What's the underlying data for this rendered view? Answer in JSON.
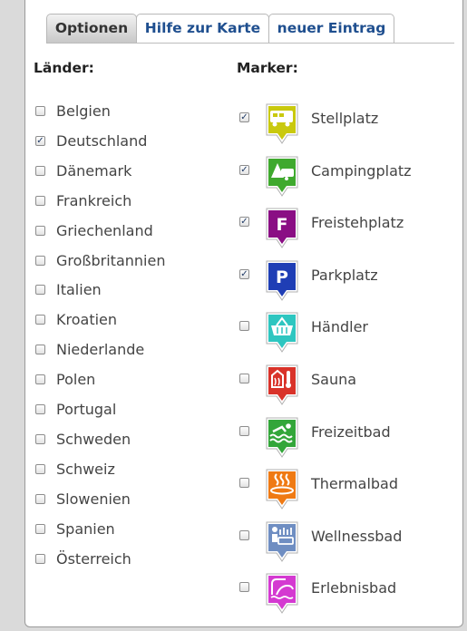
{
  "tabs": [
    {
      "label": "Optionen",
      "active": true
    },
    {
      "label": "Hilfe zur Karte",
      "active": false
    },
    {
      "label": "neuer Eintrag",
      "active": false
    }
  ],
  "countries": {
    "heading": "Länder:",
    "items": [
      {
        "label": "Belgien",
        "checked": false
      },
      {
        "label": "Deutschland",
        "checked": true
      },
      {
        "label": "Dänemark",
        "checked": false
      },
      {
        "label": "Frankreich",
        "checked": false
      },
      {
        "label": "Griechenland",
        "checked": false
      },
      {
        "label": "Großbritannien",
        "checked": false
      },
      {
        "label": "Italien",
        "checked": false
      },
      {
        "label": "Kroatien",
        "checked": false
      },
      {
        "label": "Niederlande",
        "checked": false
      },
      {
        "label": "Polen",
        "checked": false
      },
      {
        "label": "Portugal",
        "checked": false
      },
      {
        "label": "Schweden",
        "checked": false
      },
      {
        "label": "Schweiz",
        "checked": false
      },
      {
        "label": "Slowenien",
        "checked": false
      },
      {
        "label": "Spanien",
        "checked": false
      },
      {
        "label": "Österreich",
        "checked": false
      }
    ]
  },
  "markers": {
    "heading": "Marker:",
    "items": [
      {
        "label": "Stellplatz",
        "checked": true,
        "icon": "motorhome-icon",
        "color": "#c9c90e"
      },
      {
        "label": "Campingplatz",
        "checked": true,
        "icon": "tent-caravan-icon",
        "color": "#3fa92e"
      },
      {
        "label": "Freistehplatz",
        "checked": true,
        "icon": "letter-f-icon",
        "color": "#8a0e84",
        "letter": "F"
      },
      {
        "label": "Parkplatz",
        "checked": true,
        "icon": "letter-p-icon",
        "color": "#1f3eb5",
        "letter": "P"
      },
      {
        "label": "Händler",
        "checked": false,
        "icon": "shopping-basket-icon",
        "color": "#2ec6c0"
      },
      {
        "label": "Sauna",
        "checked": false,
        "icon": "sauna-icon",
        "color": "#d9332a"
      },
      {
        "label": "Freizeitbad",
        "checked": false,
        "icon": "swimmer-icon",
        "color": "#33a63a"
      },
      {
        "label": "Thermalbad",
        "checked": false,
        "icon": "thermal-spring-icon",
        "color": "#ef7a14"
      },
      {
        "label": "Wellnessbad",
        "checked": false,
        "icon": "wellness-icon",
        "color": "#6f8ec2"
      },
      {
        "label": "Erlebnisbad",
        "checked": false,
        "icon": "water-slide-icon",
        "color": "#d43ad1"
      }
    ]
  }
}
